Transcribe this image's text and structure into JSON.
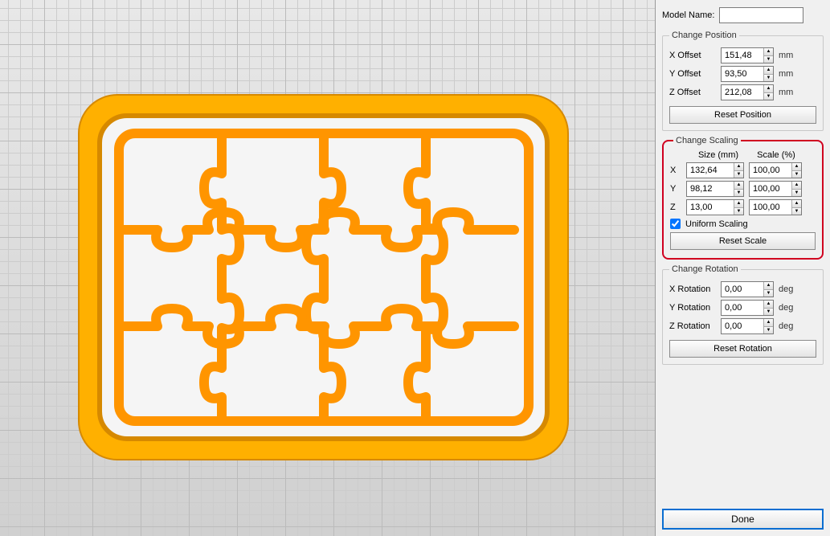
{
  "model_name": {
    "label": "Model Name:",
    "value": ""
  },
  "position": {
    "legend": "Change Position",
    "x": {
      "label": "X Offset",
      "value": "151,48",
      "unit": "mm"
    },
    "y": {
      "label": "Y Offset",
      "value": "93,50",
      "unit": "mm"
    },
    "z": {
      "label": "Z Offset",
      "value": "212,08",
      "unit": "mm"
    },
    "reset": "Reset Position"
  },
  "scaling": {
    "legend": "Change Scaling",
    "size_header": "Size (mm)",
    "scale_header": "Scale (%)",
    "x": {
      "label": "X",
      "size": "132,64",
      "scale": "100,00"
    },
    "y": {
      "label": "Y",
      "size": "98,12",
      "scale": "100,00"
    },
    "z": {
      "label": "Z",
      "size": "13,00",
      "scale": "100,00"
    },
    "uniform": {
      "label": "Uniform Scaling",
      "checked": true
    },
    "reset": "Reset Scale"
  },
  "rotation": {
    "legend": "Change Rotation",
    "x": {
      "label": "X Rotation",
      "value": "0,00",
      "unit": "deg"
    },
    "y": {
      "label": "Y Rotation",
      "value": "0,00",
      "unit": "deg"
    },
    "z": {
      "label": "Z Rotation",
      "value": "0,00",
      "unit": "deg"
    },
    "reset": "Reset Rotation"
  },
  "done": "Done"
}
